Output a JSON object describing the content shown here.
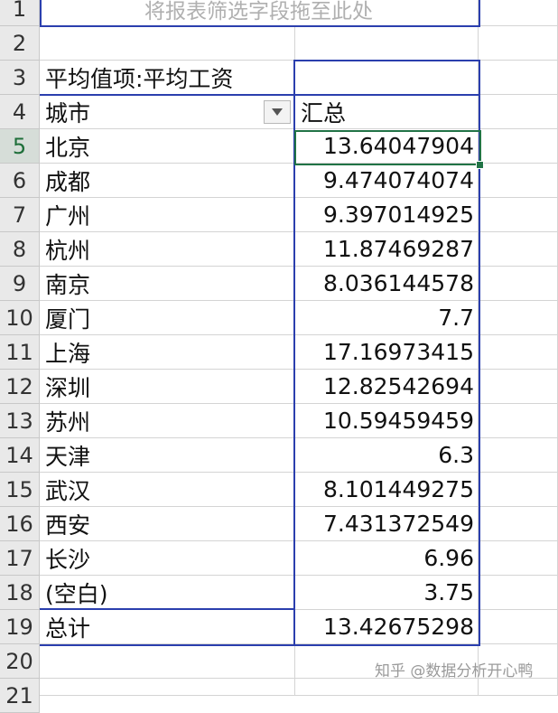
{
  "row_numbers": [
    "1",
    "2",
    "3",
    "4",
    "5",
    "6",
    "7",
    "8",
    "9",
    "10",
    "11",
    "12",
    "13",
    "14",
    "15",
    "16",
    "17",
    "18",
    "19",
    "20",
    "21"
  ],
  "pivot": {
    "drop_hint": "将报表筛选字段拖至此处",
    "value_field_label": "平均值项:平均工资",
    "row_field_label": "城市",
    "column_header": "汇总",
    "rows": [
      {
        "city": "北京",
        "value": "13.64047904"
      },
      {
        "city": "成都",
        "value": "9.474074074"
      },
      {
        "city": "广州",
        "value": "9.397014925"
      },
      {
        "city": "杭州",
        "value": "11.87469287"
      },
      {
        "city": "南京",
        "value": "8.036144578"
      },
      {
        "city": "厦门",
        "value": "7.7"
      },
      {
        "city": "上海",
        "value": "17.16973415"
      },
      {
        "city": "深圳",
        "value": "12.82542694"
      },
      {
        "city": "苏州",
        "value": "10.59459459"
      },
      {
        "city": "天津",
        "value": "6.3"
      },
      {
        "city": "武汉",
        "value": "8.101449275"
      },
      {
        "city": "西安",
        "value": "7.431372549"
      },
      {
        "city": "长沙",
        "value": "6.96"
      },
      {
        "city": "(空白)",
        "value": "3.75"
      },
      {
        "city": "总计",
        "value": "13.42675298"
      }
    ]
  },
  "selected_cell_row": "5",
  "watermark": "知乎 @数据分析开心鸭",
  "colors": {
    "pivot_border": "#2b3fae",
    "selection": "#217346"
  }
}
